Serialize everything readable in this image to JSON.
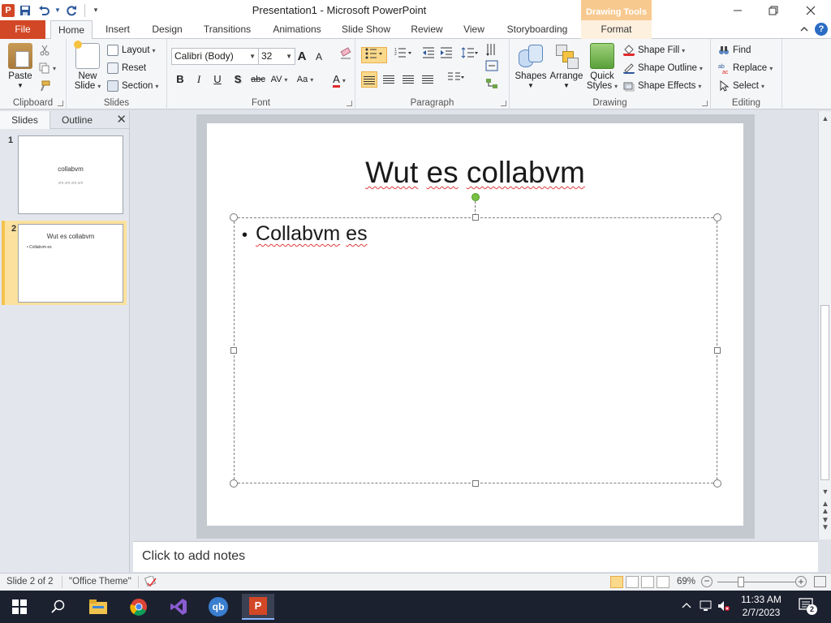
{
  "window": {
    "title": "Presentation1  -  Microsoft PowerPoint",
    "context_tab_group": "Drawing Tools",
    "controls": [
      "minimize",
      "maximize",
      "close"
    ]
  },
  "quick_access": {
    "icons": [
      "powerpoint-logo",
      "save-icon",
      "undo-icon",
      "redo-icon",
      "customize-icon"
    ],
    "logo_letter": "P"
  },
  "ribbon_tabs": [
    "File",
    "Home",
    "Insert",
    "Design",
    "Transitions",
    "Animations",
    "Slide Show",
    "Review",
    "View",
    "Storyboarding",
    "Format"
  ],
  "active_tab": "Home",
  "ribbon": {
    "clipboard": {
      "label": "Clipboard",
      "paste": "Paste"
    },
    "slides": {
      "label": "Slides",
      "new_slide_line1": "New",
      "new_slide_line2": "Slide",
      "layout": "Layout",
      "reset": "Reset",
      "section": "Section"
    },
    "font": {
      "label": "Font",
      "font_name": "Calibri (Body)",
      "font_size": "32",
      "bold": "B",
      "italic": "I",
      "underline": "U",
      "shadow": "S",
      "strike": "abc",
      "spacing": "AV",
      "case": "Aa",
      "color": "A",
      "grow": "A",
      "shrink": "A"
    },
    "paragraph": {
      "label": "Paragraph"
    },
    "drawing": {
      "label": "Drawing",
      "shapes": "Shapes",
      "arrange": "Arrange",
      "quick_styles_line1": "Quick",
      "quick_styles_line2": "Styles",
      "shape_fill": "Shape Fill",
      "shape_outline": "Shape Outline",
      "shape_effects": "Shape Effects"
    },
    "editing": {
      "label": "Editing",
      "find": "Find",
      "replace": "Replace",
      "select": "Select"
    }
  },
  "slide_panel": {
    "tabs": [
      "Slides",
      "Outline"
    ],
    "thumbnails": [
      {
        "number": "1",
        "title": "collabvm",
        "subtitle": "vm.vm.vm.vm"
      },
      {
        "number": "2",
        "title": "Wut es collabvm",
        "bullet": "Collabvm es"
      }
    ]
  },
  "slide": {
    "title_parts": [
      "Wut",
      "es",
      "collabvm"
    ],
    "bullet_parts": [
      "Collabvm",
      "es"
    ]
  },
  "notes": {
    "placeholder": "Click to add notes"
  },
  "status_bar": {
    "slide_info": "Slide 2 of 2",
    "theme": "\"Office Theme\"",
    "zoom": "69%",
    "zoom_fraction": 0.5
  },
  "taskbar": {
    "apps": [
      "windows-start-icon",
      "search-icon",
      "file-explorer-icon",
      "chrome-icon",
      "visual-studio-icon",
      "qbittorrent-icon",
      "powerpoint-icon"
    ],
    "qb_label": "qb",
    "time": "11:33 AM",
    "date": "2/7/2023",
    "notification_count": "2"
  },
  "colors": {
    "accent": "#d24726",
    "selected_slide": "#fbe19d",
    "drawing_tools": "#f8c98f"
  }
}
